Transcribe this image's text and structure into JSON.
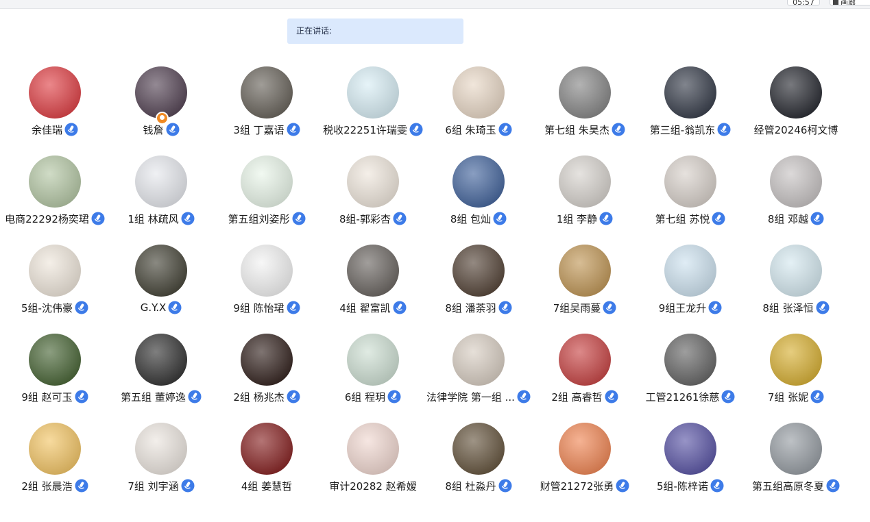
{
  "toolbar": {
    "timer_text": "05:57",
    "layout_label": "画廊"
  },
  "speaking_bar": {
    "label": "正在讲话:"
  },
  "participants": [
    {
      "name": "余佳瑞",
      "mic": true
    },
    {
      "name": "钱詹",
      "mic": true,
      "host": true
    },
    {
      "name": "3组 丁嘉语",
      "mic": true
    },
    {
      "name": "税收22251许瑞雯",
      "mic": true
    },
    {
      "name": "6组 朱琦玉",
      "mic": true
    },
    {
      "name": "第七组 朱昊杰",
      "mic": true
    },
    {
      "name": "第三组-翁凯东",
      "mic": true
    },
    {
      "name": "经管20246柯文博",
      "mic": false
    },
    {
      "name": "电商22292杨奕珺",
      "mic": true
    },
    {
      "name": "1组 林疏风",
      "mic": true
    },
    {
      "name": "第五组刘姿彤",
      "mic": true
    },
    {
      "name": "8组-郭彩杏",
      "mic": true
    },
    {
      "name": "8组 包灿",
      "mic": true
    },
    {
      "name": "1组 李静",
      "mic": true
    },
    {
      "name": "第七组 苏悦",
      "mic": true
    },
    {
      "name": "8组 邓越",
      "mic": true
    },
    {
      "name": "5组-沈伟豪",
      "mic": true
    },
    {
      "name": "G.Y.X",
      "mic": true
    },
    {
      "name": "9组 陈怡珺",
      "mic": true
    },
    {
      "name": "4组 翟富凯",
      "mic": true
    },
    {
      "name": "8组 潘荼羽",
      "mic": true
    },
    {
      "name": "7组吴雨蔓",
      "mic": true
    },
    {
      "name": "9组王龙升",
      "mic": true
    },
    {
      "name": "8组 张泽恒",
      "mic": true
    },
    {
      "name": "9组  赵可玉",
      "mic": true
    },
    {
      "name": "第五组 董婷逸",
      "mic": true
    },
    {
      "name": "2组 杨兆杰",
      "mic": true
    },
    {
      "name": "6组 程玥",
      "mic": true
    },
    {
      "name": "法律学院 第一组 ...",
      "mic": true
    },
    {
      "name": "2组 高睿哲",
      "mic": true
    },
    {
      "name": "工管21261徐慈",
      "mic": true
    },
    {
      "name": "7组 张妮",
      "mic": true
    },
    {
      "name": "2组 张晨浩",
      "mic": true
    },
    {
      "name": "7组 刘宇涵",
      "mic": true
    },
    {
      "name": "4组 姜慧哲",
      "mic": false
    },
    {
      "name": "审计20282 赵希嫒",
      "mic": false
    },
    {
      "name": "8组 杜淼丹",
      "mic": true
    },
    {
      "name": "财管21272张勇",
      "mic": true
    },
    {
      "name": "5组-陈梓诺",
      "mic": true
    },
    {
      "name": "第五组高原冬夏",
      "mic": true
    }
  ],
  "avatar_colors": [
    "#e0474c",
    "#5a4a5a",
    "#6d6860",
    "#d9eef5",
    "#e9d9c8",
    "#8a8a8a",
    "#3d4350",
    "#2f3138",
    "#b7c9a8",
    "#e7e9ee",
    "#eaf6ea",
    "#efe7dd",
    "#4a6aa0",
    "#d8d4cf",
    "#d9d2cc",
    "#c9c5c5",
    "#efe7dc",
    "#4b4a3e",
    "#f3f3f3",
    "#6f6a66",
    "#5a4a3e",
    "#c29a5c",
    "#cfe3f0",
    "#d6e9f0",
    "#4e6a3c",
    "#3a3a3a",
    "#3a2a26",
    "#cfe0d4",
    "#d9cfc4",
    "#c94a4a",
    "#6a6a6a",
    "#d8b23a",
    "#f3c76b",
    "#ece6e0",
    "#8b2a2a",
    "#f1d9d2",
    "#6a5a44",
    "#f08a5a",
    "#5f5aa8",
    "#9aa0a6"
  ],
  "mic_color": "#3d7be8"
}
